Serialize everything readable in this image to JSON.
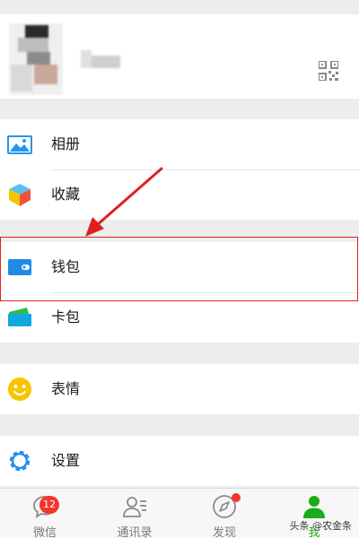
{
  "profile": {
    "avatar_icon": "avatar-blurred",
    "qr_icon": "qr-code-icon"
  },
  "menu": {
    "album": {
      "label": "相册",
      "icon": "photo-album-icon",
      "color": "#2196f3"
    },
    "favorites": {
      "label": "收藏",
      "icon": "cube-favorites-icon",
      "color": "#f0503c"
    },
    "wallet": {
      "label": "钱包",
      "icon": "wallet-icon",
      "color": "#1e8be6"
    },
    "cards": {
      "label": "卡包",
      "icon": "card-holder-icon",
      "color": "#11a8e0"
    },
    "stickers": {
      "label": "表情",
      "icon": "smiley-icon",
      "color": "#f6c400"
    },
    "settings": {
      "label": "设置",
      "icon": "gear-icon",
      "color": "#2d8cf0"
    }
  },
  "annotation": {
    "highlight_color": "#e02020"
  },
  "tabbar": {
    "tabs": [
      {
        "label": "微信",
        "icon": "chat-bubble-icon",
        "badge": "12"
      },
      {
        "label": "通讯录",
        "icon": "contacts-icon"
      },
      {
        "label": "发现",
        "icon": "compass-icon",
        "has_dot": true
      },
      {
        "label": "我",
        "icon": "person-icon",
        "active": true
      }
    ],
    "active_color": "#1aad19"
  },
  "watermark": "头条 @农金条"
}
